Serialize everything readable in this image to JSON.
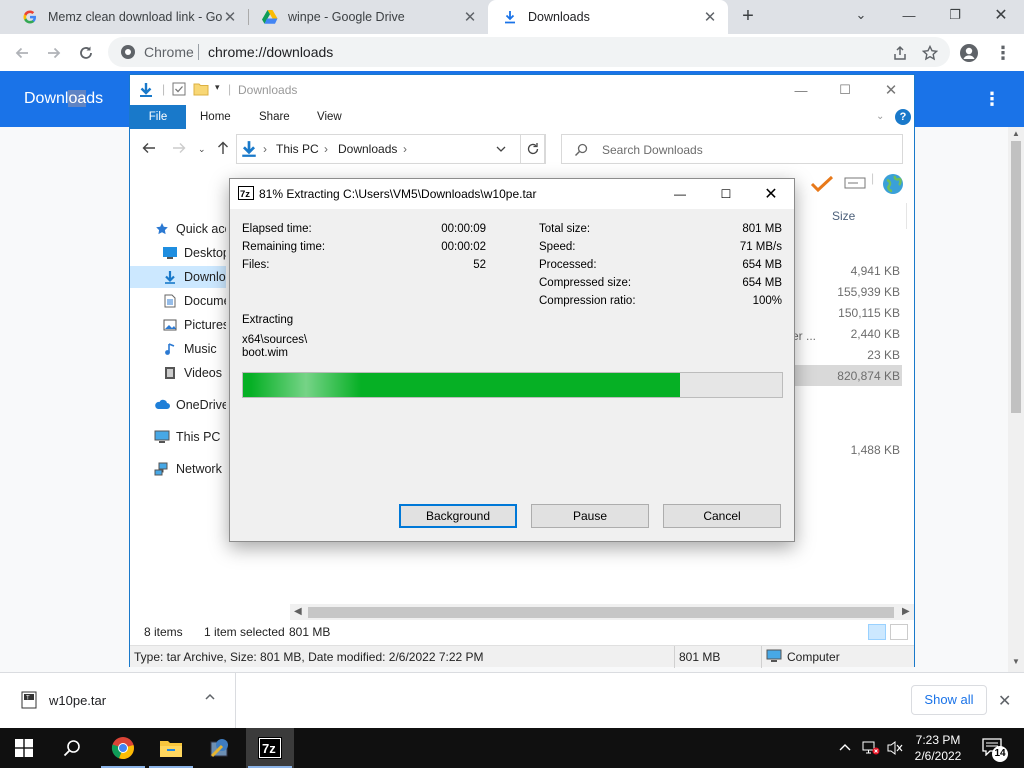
{
  "browser": {
    "tabs": [
      {
        "title": "Memz clean download link - Goo",
        "icon": "google-g-icon",
        "active": false
      },
      {
        "title": "winpe - Google Drive",
        "icon": "google-drive-icon",
        "active": false
      },
      {
        "title": "Downloads",
        "icon": "download-icon",
        "active": true
      }
    ],
    "omnibox": {
      "site": "Chrome",
      "url": "chrome://downloads"
    }
  },
  "downloads_page": {
    "title": "Downloads",
    "title_parts": [
      "Downl",
      "oa",
      "ds"
    ]
  },
  "explorer": {
    "title": "Downloads",
    "ribbon_tabs": [
      "File",
      "Home",
      "Share",
      "View"
    ],
    "breadcrumb": [
      "This PC",
      "Downloads"
    ],
    "search_placeholder": "Search Downloads",
    "column_size": "Size",
    "nav": [
      {
        "label": "Quick access",
        "icon": "star-icon"
      },
      {
        "label": "Desktop",
        "icon": "desktop-icon"
      },
      {
        "label": "Downloads",
        "icon": "download-arrow-icon",
        "selected": true
      },
      {
        "label": "Documents",
        "icon": "document-icon"
      },
      {
        "label": "Pictures",
        "icon": "pictures-icon"
      },
      {
        "label": "Music",
        "icon": "music-icon"
      },
      {
        "label": "Videos",
        "icon": "videos-icon"
      },
      {
        "label": "OneDrive",
        "icon": "cloud-icon"
      },
      {
        "label": "This PC",
        "icon": "computer-icon"
      },
      {
        "label": "Network",
        "icon": "network-icon"
      }
    ],
    "file_sizes": [
      "4,941 KB",
      "155,939 KB",
      "150,115 KB",
      "2,440 KB",
      "23 KB",
      "820,874 KB",
      "1,488 KB"
    ],
    "type_fragment": "er ...",
    "status": {
      "items": "8 items",
      "selected": "1 item selected",
      "selected_size": "801 MB"
    },
    "details": {
      "info": "Type: tar Archive, Size: 801 MB, Date modified: 2/6/2022 7:22 PM",
      "size": "801 MB",
      "location": "Computer"
    }
  },
  "sevenzip": {
    "title": "81% Extracting C:\\Users\\VM5\\Downloads\\w10pe.tar",
    "percent": 81,
    "left": [
      {
        "label": "Elapsed time:",
        "value": "00:00:09"
      },
      {
        "label": "Remaining time:",
        "value": "00:00:02"
      },
      {
        "label": "Files:",
        "value": "52"
      }
    ],
    "right": [
      {
        "label": "Total size:",
        "value": "801 MB"
      },
      {
        "label": "Speed:",
        "value": "71 MB/s"
      },
      {
        "label": "Processed:",
        "value": "654 MB"
      },
      {
        "label": "Compressed size:",
        "value": "654 MB"
      },
      {
        "label": "Compression ratio:",
        "value": "100%"
      }
    ],
    "operation": "Extracting",
    "current_path": "x64\\sources\\",
    "current_file": "boot.wim",
    "buttons": {
      "background": "Background",
      "pause": "Pause",
      "cancel": "Cancel"
    }
  },
  "shelf": {
    "file": "w10pe.tar",
    "show_all": "Show all"
  },
  "taskbar": {
    "time": "7:23 PM",
    "date": "2/6/2022",
    "notifications": "14",
    "apps": [
      "chrome-icon",
      "file-explorer-icon",
      "setup-app-icon",
      "sevenzip-icon"
    ]
  },
  "colors": {
    "chrome_blue": "#1a73e8",
    "progress_green": "#06b025",
    "explorer_blue": "#1979ca",
    "taskbar": "#101010"
  }
}
